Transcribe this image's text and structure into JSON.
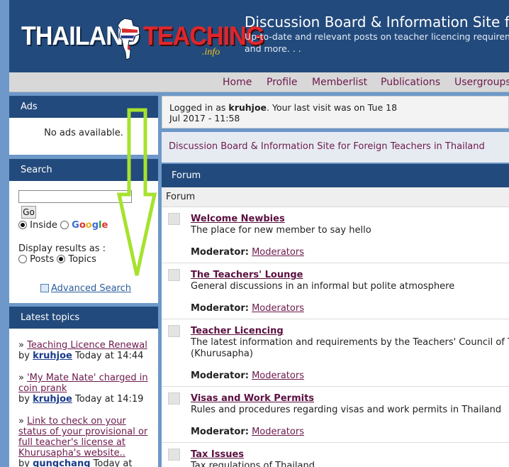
{
  "header": {
    "logo_main": "THAILAND",
    "logo_accent": "TEACHING",
    "logo_suffix": ".info",
    "site_title": "Discussion Board & Information Site f",
    "site_desc_line1": "Up-to-date and relevant posts on teacher licencing requirem",
    "site_desc_line2": "and more. . ."
  },
  "nav": [
    "Home",
    "Profile",
    "Memberlist",
    "Publications",
    "Usergroups"
  ],
  "sidebar": {
    "ads": {
      "title": "Ads",
      "body": "No ads available."
    },
    "search": {
      "title": "Search",
      "input_value": "",
      "go_label": "Go",
      "inside_label": "Inside",
      "google_letters": [
        "G",
        "o",
        "o",
        "g",
        "l",
        "e"
      ],
      "display_label": "Display results as :",
      "posts_label": "Posts",
      "topics_label": "Topics",
      "advanced_label": "Advanced Search"
    },
    "latest": {
      "title": "Latest topics",
      "by": "by",
      "topics": [
        {
          "title": "Teaching Licence Renewal",
          "user": "kruhjoe",
          "time": "Today at 14:44"
        },
        {
          "title_line1": "'My Mate Nate' charged in",
          "title_line2": "coin prank",
          "user": "kruhjoe",
          "time": "Today at 14:19"
        },
        {
          "title_line1": "Link to check on your",
          "title_line2": "status of your provisional or",
          "title_line3": "full teacher's license at",
          "title_line4": "Khurusapha's website..",
          "user": "gungchang",
          "time": "Today at"
        }
      ]
    }
  },
  "main": {
    "login_prefix": "Logged in as",
    "login_user": "kruhjoe",
    "login_suffix": ". Your last visit was on Tue 18",
    "login_line2": "Jul 2017 - 11:58",
    "description": "Discussion Board & Information Site for Foreign Teachers in Thailand",
    "forum_header": "Forum",
    "forum_subheader": "Forum",
    "moderator_label": "Moderator:",
    "moderators_link": "Moderators",
    "forums": [
      {
        "title": "Welcome Newbies",
        "desc": "The place for new member to say hello"
      },
      {
        "title": "The Teachers' Lounge",
        "desc": "General discussions in an informal but polite atmosphere"
      },
      {
        "title": "Teacher Licencing",
        "desc": "The latest information and requirements by the Teachers' Council of Tha",
        "desc2": "(Khurusapha)"
      },
      {
        "title": "Visas and Work Permits",
        "desc": "Rules and procedures regarding visas and work permits in Thailand"
      },
      {
        "title": "Tax Issues",
        "desc": "Tax regulations of Thailand"
      }
    ]
  },
  "colors": {
    "header_bg": "#234a7c",
    "page_bg": "#6d98c9",
    "link_purple": "#6d1a4d",
    "arrow_green": "#a6e22e"
  }
}
